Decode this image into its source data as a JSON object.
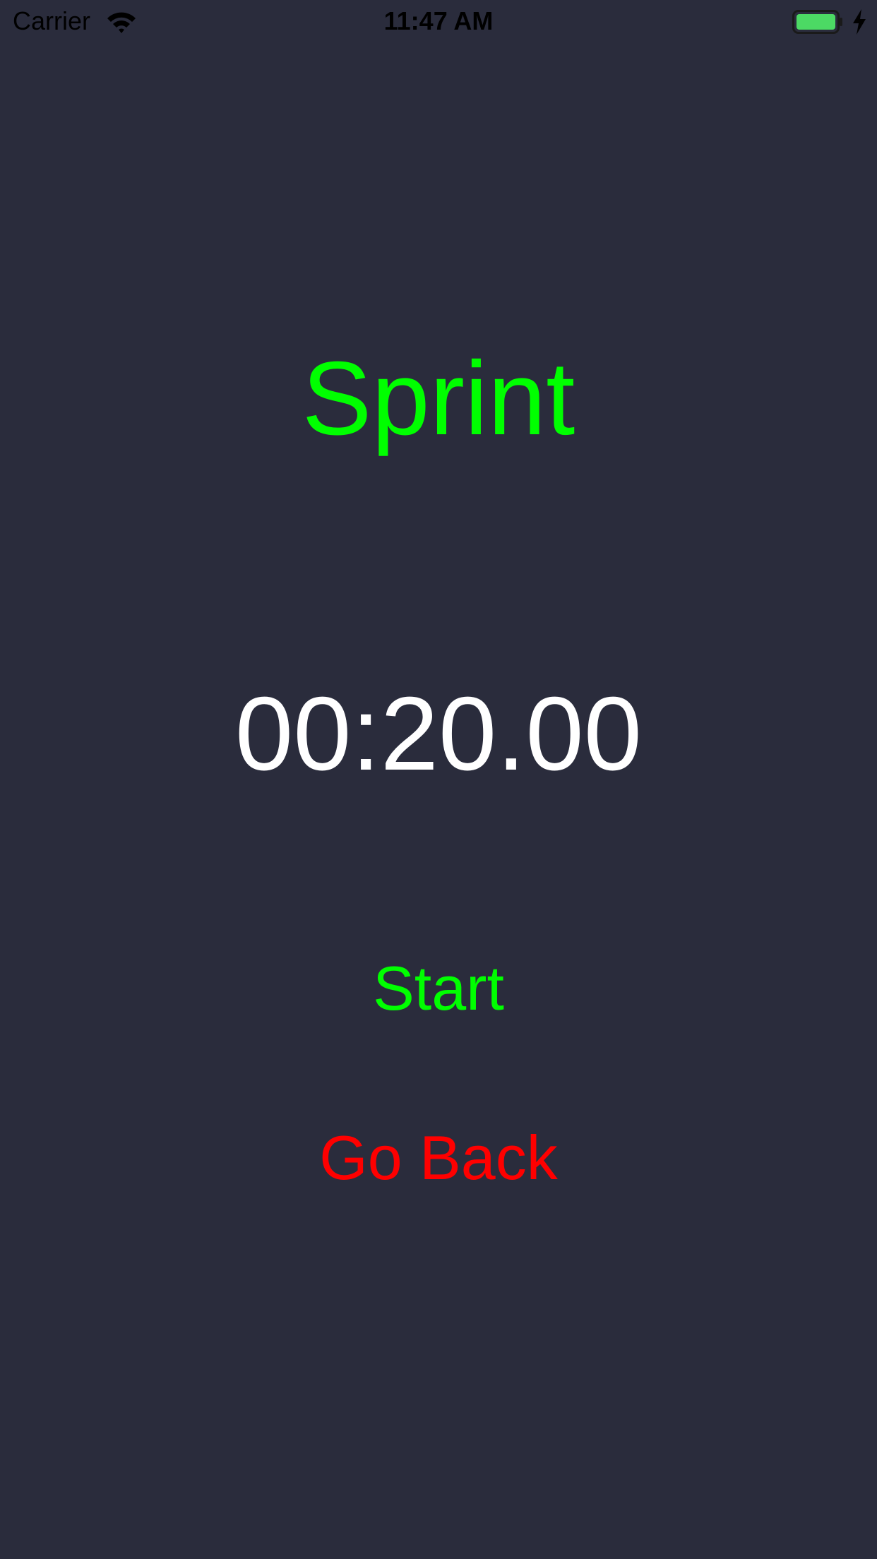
{
  "status_bar": {
    "carrier": "Carrier",
    "time": "11:47 AM",
    "battery_color": "#4cd964",
    "icons": [
      "wifi-icon",
      "battery-icon",
      "charging-bolt-icon"
    ]
  },
  "screen": {
    "title": "Sprint",
    "timer_display": "00:20.00",
    "start_label": "Start",
    "go_back_label": "Go Back"
  },
  "colors": {
    "background": "#2a2c3c",
    "title": "#00ff00",
    "timer": "#ffffff",
    "start": "#00ff00",
    "go_back": "#ff0000"
  }
}
